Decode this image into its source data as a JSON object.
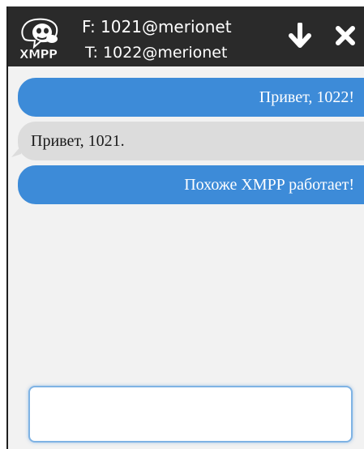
{
  "header": {
    "logo_text": "XMPP",
    "from_label": "F: 1021@merionet",
    "to_label": "T: 1022@merionet",
    "download_icon": "arrow-down-icon",
    "close_icon": "close-icon"
  },
  "messages": [
    {
      "direction": "outgoing",
      "text": "Привет, 1022!"
    },
    {
      "direction": "incoming",
      "text": "Привет, 1021."
    },
    {
      "direction": "outgoing",
      "text": "Похоже XMPP работает!"
    }
  ],
  "composer": {
    "value": "",
    "placeholder": ""
  },
  "colors": {
    "header_bg": "#2a2a2a",
    "outgoing_bubble": "#3d8bd8",
    "incoming_bubble": "#dcdcdc",
    "chat_bg": "#f2f2f2",
    "input_border": "#7fb3e4"
  }
}
